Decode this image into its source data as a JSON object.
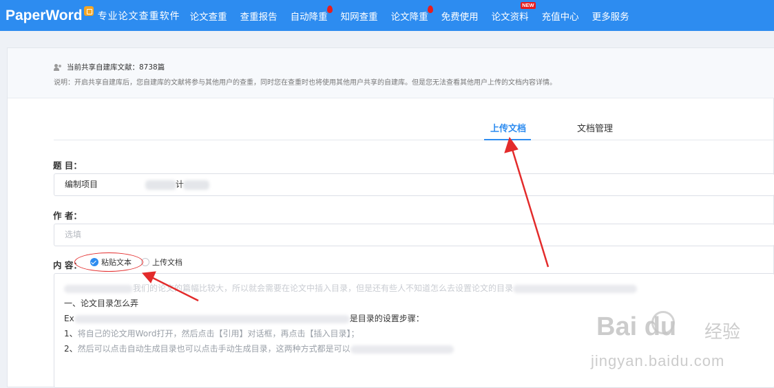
{
  "brand": {
    "name": "PaperWord",
    "slogan": "专业论文查重软件"
  },
  "nav": {
    "items": [
      {
        "label": "论文查重",
        "badge": ""
      },
      {
        "label": "查重报告",
        "badge": ""
      },
      {
        "label": "自动降重",
        "badge": "flame"
      },
      {
        "label": "知网查重",
        "badge": ""
      },
      {
        "label": "论文降重",
        "badge": "flame"
      },
      {
        "label": "免费使用",
        "badge": ""
      },
      {
        "label": "论文资料",
        "badge": "NEW"
      },
      {
        "label": "充值中心",
        "badge": ""
      },
      {
        "label": "更多服务",
        "badge": ""
      }
    ]
  },
  "notice": {
    "title": "当前共享自建库文献：8738篇",
    "description": "说明：开启共享自建库后，您自建库的文献将参与其他用户的查重，同时您在查重时也将使用其他用户共享的自建库。但是您无法查看其他用户上传的文档内容详情。"
  },
  "tabs": [
    {
      "label": "上传文档",
      "active": true
    },
    {
      "label": "文档管理",
      "active": false
    }
  ],
  "form": {
    "title_label": "题 目：",
    "title_value": "编制项目",
    "title_value_tail": "计",
    "author_label": "作 者：",
    "author_placeholder": "选填",
    "content_label": "内 容：",
    "content_options": [
      {
        "label": "粘贴文本",
        "checked": true
      },
      {
        "label": "上传文档",
        "checked": false
      }
    ],
    "content_lines": [
      {
        "before": "",
        "middle": "我们的论文的篇幅比较大，所以就会需要在论文中插入目录，但是还有些人不知道怎么去设置论文的目录",
        "after": ""
      },
      {
        "before": "一、论文目录怎么弄",
        "middle": "",
        "after": ""
      },
      {
        "before": "Ex",
        "middle": "是目录的设置步骤：",
        "after": ""
      },
      {
        "before": "1、",
        "middle": "将自己的论文用Word打开，然后点击【引用】对话框，再点击【插入目录】；",
        "after": ""
      },
      {
        "before": "2、",
        "middle": "然后可以点击自动生成目录也可以点击手动生成目录，这两种方式都是可以",
        "after": ""
      }
    ]
  },
  "watermark": {
    "brand": "Bai du",
    "cn": "经验",
    "url": "jingyan.baidu.com"
  },
  "colors": {
    "nav_bg": "#2d8cf0",
    "accent": "#2d8cf0",
    "annotation": "#e32b2b"
  }
}
